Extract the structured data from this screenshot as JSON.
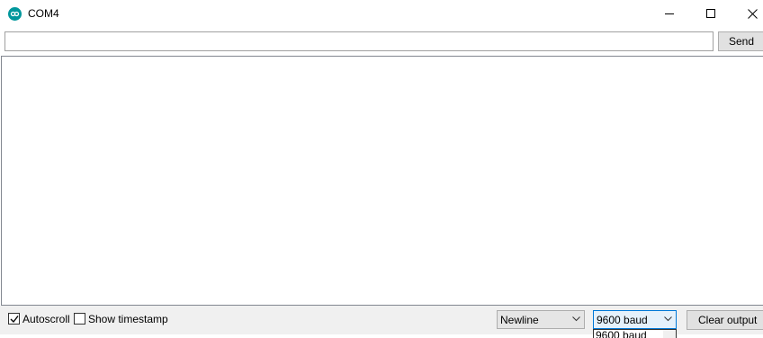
{
  "window": {
    "title": "COM4",
    "app_icon": "arduino-infinity-icon",
    "controls": [
      "minimize-icon",
      "maximize-icon",
      "close-icon"
    ]
  },
  "send_bar": {
    "input_value": "",
    "send_label": "Send"
  },
  "footer": {
    "autoscroll_label": "Autoscroll",
    "autoscroll_checked": true,
    "timestamp_label": "Show timestamp",
    "timestamp_checked": false,
    "line_ending": "Newline",
    "baud": "9600 baud",
    "clear_label": "Clear output"
  },
  "baud_dropdown": {
    "visible_option": "9600 baud"
  },
  "colors": {
    "accent": "#0078d7",
    "arduino_teal": "#00979c",
    "footer_bg": "#f0f0f0"
  }
}
